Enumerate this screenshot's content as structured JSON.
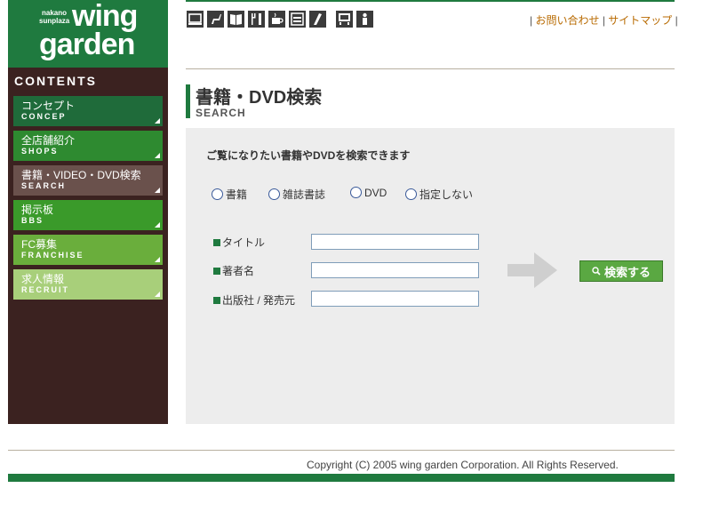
{
  "logo": {
    "small_top": "nakano",
    "small_bottom": "sunplaza",
    "word1": "wing",
    "word2": "garden"
  },
  "sidebar": {
    "heading": "CONTENTS",
    "items": [
      {
        "jp": "コンセプト",
        "en": "CONCEP",
        "color": "#1f6b3a"
      },
      {
        "jp": "全店舗紹介",
        "en": "SHOPS",
        "color": "#2e8a30"
      },
      {
        "jp": "書籍・VIDEO・DVD検索",
        "en": "SEARCH",
        "color": "#6a514c"
      },
      {
        "jp": "掲示板",
        "en": "BBS",
        "color": "#3a9a2a"
      },
      {
        "jp": "FC募集",
        "en": "FRANCHISE",
        "color": "#6aae3c"
      },
      {
        "jp": "求人情報",
        "en": "RECRUIT",
        "color": "#a8cf7a"
      }
    ]
  },
  "top_icons": [
    "computer-icon",
    "chair-icon",
    "book-icon",
    "restaurant-icon",
    "coffee-icon",
    "burger-icon",
    "hairdresser-icon",
    "shop-icon",
    "person-icon"
  ],
  "header": {
    "separator": "|",
    "contact": "お問い合わせ",
    "sitemap": "サイトマップ"
  },
  "page": {
    "title": "書籍・DVD検索",
    "subtitle": "SEARCH"
  },
  "search": {
    "intro": "ご覧になりたい書籍やDVDを検索できます",
    "radios": [
      "書籍",
      "雑誌書誌",
      "DVD",
      "指定しない"
    ],
    "fields": [
      {
        "label": "タイトル",
        "value": ""
      },
      {
        "label": "著者名",
        "value": ""
      },
      {
        "label": "出版社 / 発売元",
        "value": ""
      }
    ],
    "button": "検索する"
  },
  "footer": {
    "copyright": "Copyright (C) 2005 wing garden Corporation. All Rights Reserved."
  }
}
